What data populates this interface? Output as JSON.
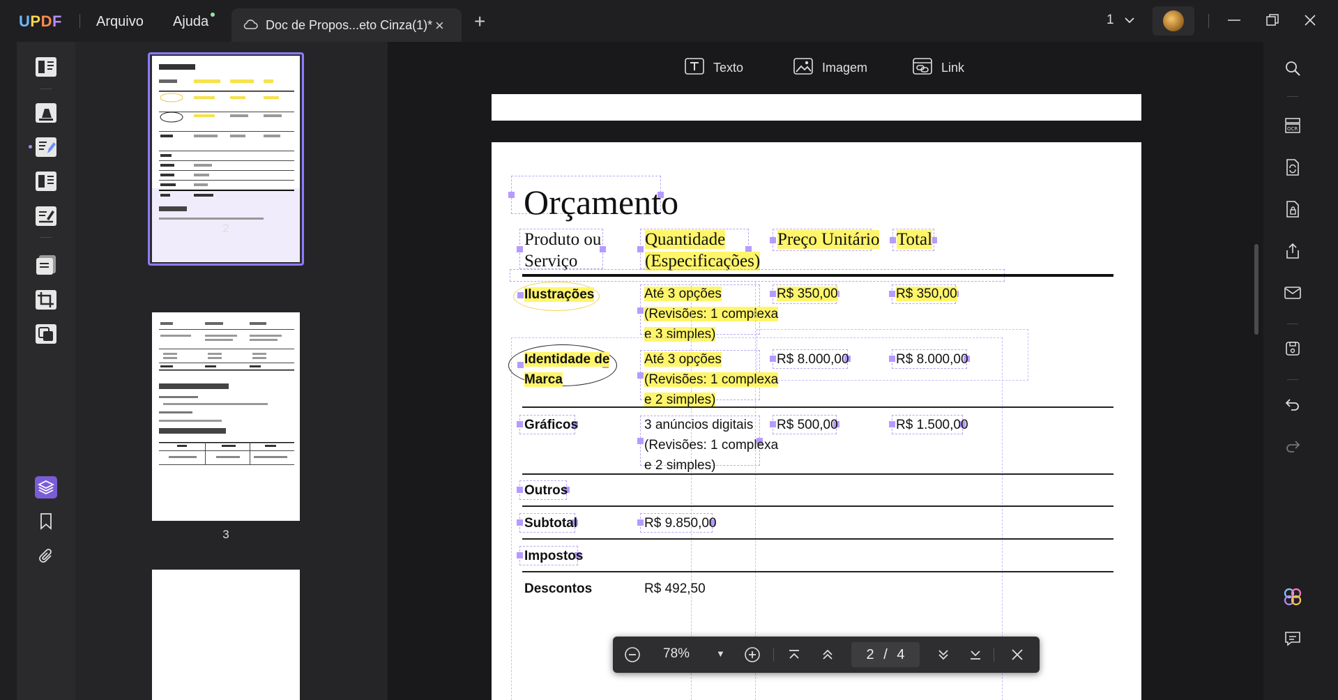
{
  "app": {
    "logo": "UPDF",
    "menu": {
      "file": "Arquivo",
      "help": "Ajuda"
    },
    "tab": {
      "title": "Doc de Propos...eto Cinza(1)*"
    },
    "page_selector": "1"
  },
  "edit_toolbar": {
    "text": "Texto",
    "image": "Imagem",
    "link": "Link"
  },
  "thumbnails": [
    {
      "page_number": "2"
    },
    {
      "page_number": "3"
    },
    {
      "page_number": ""
    }
  ],
  "document": {
    "title": "Orçamento",
    "headers": {
      "product": [
        "Produto ou",
        "Serviço"
      ],
      "quantity": [
        "Quantidade",
        "(Especificações)"
      ],
      "unit_price": "Preço Unitário",
      "total": "Total"
    },
    "rows": [
      {
        "name": "Ilustrações",
        "spec": [
          "Até 3 opções",
          "(Revisões: 1 complexa",
          "e 3 simples)"
        ],
        "unit": "R$ 350,00",
        "total": "R$ 350,00"
      },
      {
        "name": [
          "Identidade de",
          "Marca"
        ],
        "spec": [
          "Até 3 opções",
          "(Revisões: 1 complexa",
          "e 2 simples)"
        ],
        "unit": "R$ 8.000,00",
        "total": "R$ 8.000,00"
      },
      {
        "name": "Gráficos",
        "spec": [
          "3 anúncios digitais",
          "(Revisões: 1 complexa",
          "e 2 simples)"
        ],
        "unit": "R$ 500,00",
        "total": "R$ 1.500,00"
      },
      {
        "name": "Outros"
      },
      {
        "name": "Subtotal",
        "spec": "R$ 9.850,00"
      },
      {
        "name": "Impostos"
      },
      {
        "name": "Descontos",
        "spec": "R$ 492,50"
      }
    ]
  },
  "zoom_bar": {
    "zoom": "78%",
    "current_page": "2",
    "separator": "/",
    "total_pages": "4"
  }
}
